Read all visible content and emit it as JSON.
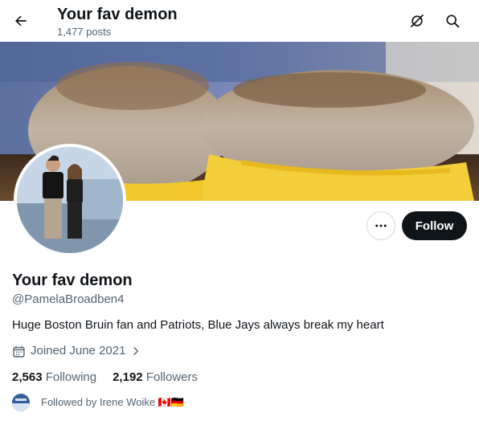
{
  "header": {
    "title": "Your fav demon",
    "post_count": "1,477 posts"
  },
  "profile": {
    "display_name": "Your fav demon",
    "handle": "@PamelaBroadben4",
    "bio": "Huge Boston Bruin fan and Patriots, Blue Jays always break my heart",
    "joined": "Joined June 2021",
    "following_count": "2,563",
    "following_label": "Following",
    "followers_count": "2,192",
    "followers_label": "Followers",
    "followed_by": "Followed by Irene Woike 🇨🇦🇩🇪"
  },
  "actions": {
    "follow_label": "Follow",
    "more_label": "···"
  },
  "colors": {
    "text_primary": "#0f1419",
    "text_secondary": "#536471",
    "follow_bg": "#0f1419",
    "border": "#cfd9de"
  },
  "icons": [
    "back-arrow-icon",
    "hide-repost-icon",
    "search-icon",
    "more-icon",
    "calendar-icon",
    "chevron-right-icon"
  ]
}
